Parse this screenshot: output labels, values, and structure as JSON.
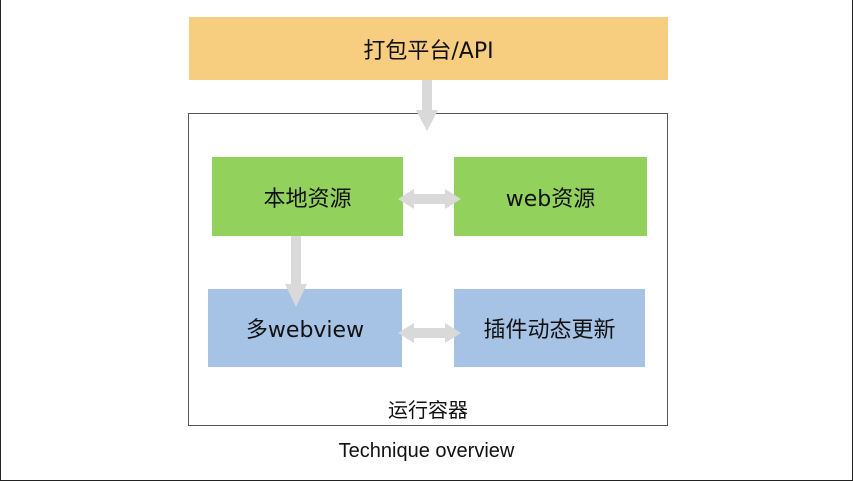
{
  "diagram": {
    "top_box": "打包平台/API",
    "local_resource": "本地资源",
    "web_resource": "web资源",
    "multi_webview": "多webview",
    "plugin_update": "插件动态更新",
    "container_label": "运行容器",
    "caption": "Technique overview"
  },
  "colors": {
    "top_box": "#f7cd7f",
    "green": "#92d25c",
    "blue": "#a6c3e6",
    "arrow": "#d9d9d9"
  }
}
